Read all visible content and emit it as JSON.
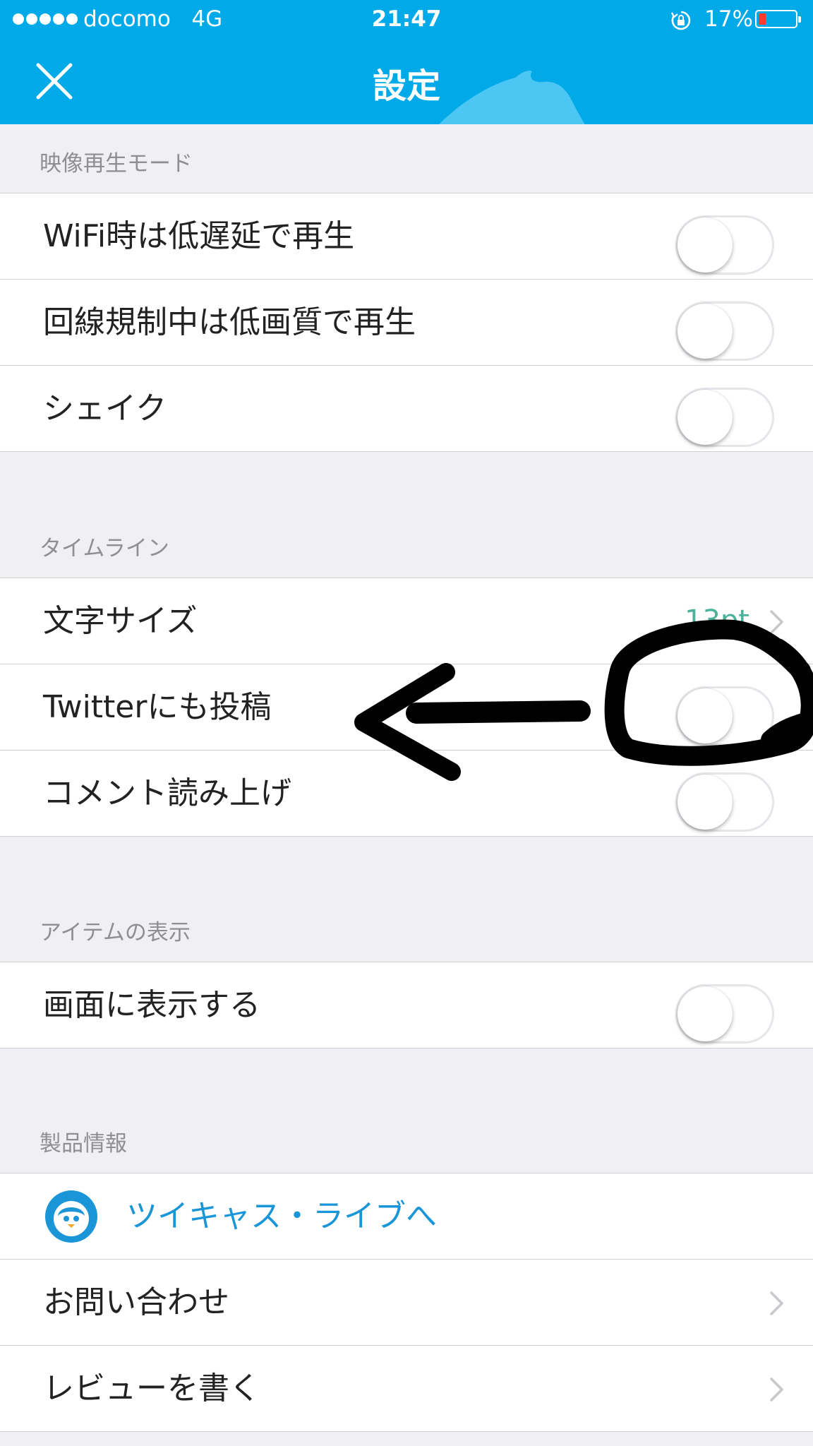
{
  "status_bar": {
    "carrier": "docomo",
    "network": "4G",
    "time": "21:47",
    "battery": "17%"
  },
  "header": {
    "title": "設定"
  },
  "sections": {
    "video": {
      "title": "映像再生モード",
      "items": [
        {
          "label": "WiFi時は低遅延で再生",
          "toggle_on": false
        },
        {
          "label": "回線規制中は低画質で再生",
          "toggle_on": false
        },
        {
          "label": "シェイク",
          "toggle_on": false
        }
      ]
    },
    "timeline": {
      "title": "タイムライン",
      "items": [
        {
          "label": "文字サイズ",
          "value": "13pt"
        },
        {
          "label": "Twitterにも投稿",
          "toggle_on": false
        },
        {
          "label": "コメント読み上げ",
          "toggle_on": false
        }
      ]
    },
    "items_display": {
      "title": "アイテムの表示",
      "items": [
        {
          "label": "画面に表示する",
          "toggle_on": false
        }
      ]
    },
    "product": {
      "title": "製品情報",
      "items": [
        {
          "label": "ツイキャス・ライブへ"
        },
        {
          "label": "お問い合わせ"
        },
        {
          "label": "レビューを書く"
        }
      ]
    }
  },
  "colors": {
    "header": "#00aae8",
    "link": "#1a96d8",
    "value": "#4cb39a",
    "background": "#efeff4",
    "battery_low": "#ff3b30"
  }
}
